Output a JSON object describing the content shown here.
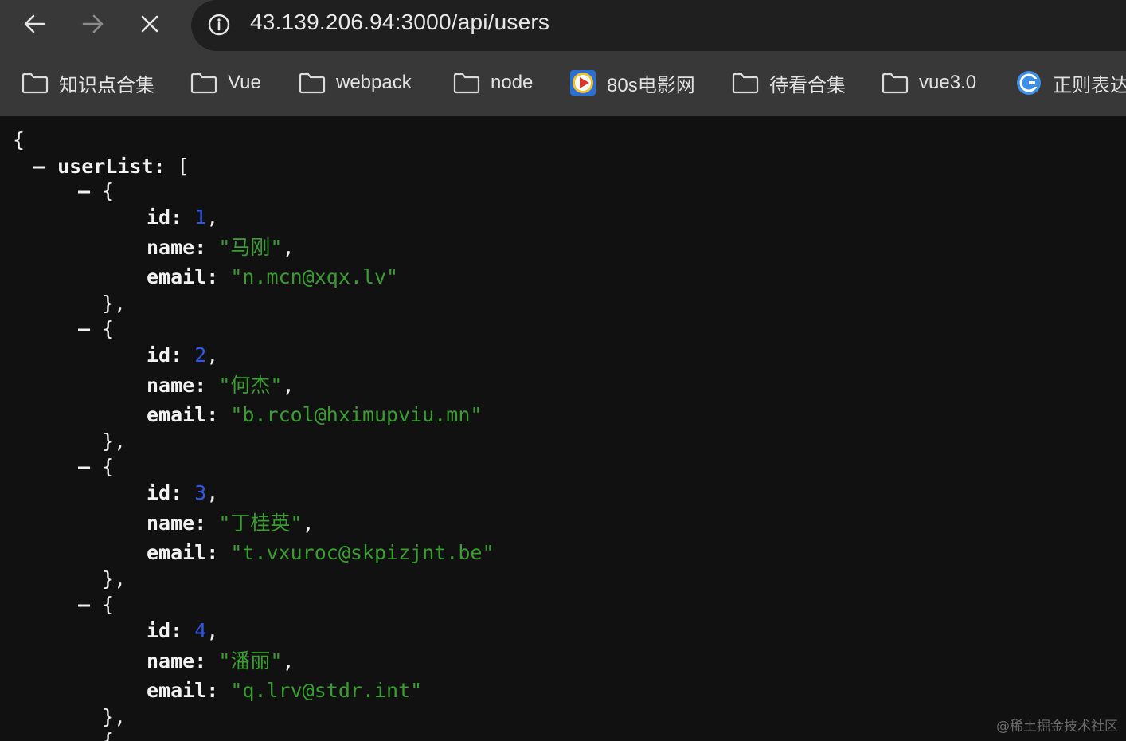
{
  "browser": {
    "url": "43.139.206.94:3000/api/users",
    "back_icon": "arrow-left-icon",
    "forward_icon": "arrow-right-icon",
    "stop_icon": "close-icon",
    "info_icon": "info-icon"
  },
  "bookmarks": [
    {
      "label": "知识点合集",
      "icon": "folder-icon"
    },
    {
      "label": "Vue",
      "icon": "folder-icon"
    },
    {
      "label": "webpack",
      "icon": "folder-icon"
    },
    {
      "label": "node",
      "icon": "folder-icon"
    },
    {
      "label": "80s电影网",
      "icon": "play-favicon-icon"
    },
    {
      "label": "待看合集",
      "icon": "folder-icon"
    },
    {
      "label": "vue3.0",
      "icon": "folder-icon"
    },
    {
      "label": "正则表达",
      "icon": "regex-favicon-icon"
    }
  ],
  "json_view": {
    "open_brace": "{",
    "collapse_symbol": "–",
    "root_key": "userList:",
    "open_bracket": "[",
    "users": [
      {
        "id": "1",
        "name": "\"马刚\"",
        "email": "\"n.mcn@xqx.lv\""
      },
      {
        "id": "2",
        "name": "\"何杰\"",
        "email": "\"b.rcol@hximupviu.mn\""
      },
      {
        "id": "3",
        "name": "\"丁桂英\"",
        "email": "\"t.vxuroc@skpizjnt.be\""
      },
      {
        "id": "4",
        "name": "\"潘丽\"",
        "email": "\"q.lrv@stdr.int\""
      }
    ],
    "labels": {
      "id": "id:",
      "name": "name:",
      "email": "email:"
    },
    "item_open": "{",
    "item_close": "},",
    "comma": ",",
    "partial_next": "{"
  },
  "watermark": "@稀土掘金技术社区",
  "colors": {
    "background": "#111111",
    "toolbar": "#383838",
    "number": "#2f56e8",
    "string": "#3a9d31"
  }
}
